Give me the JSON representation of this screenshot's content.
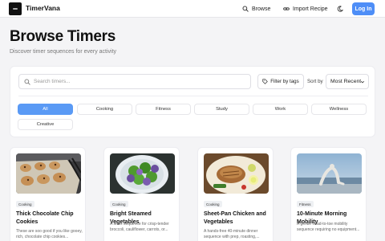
{
  "navbar": {
    "brand": "TimerVana",
    "logo_icon": "stopwatch-logo-icon",
    "links": [
      {
        "label": "Browse",
        "icon": "search-icon"
      },
      {
        "label": "Import Recipe",
        "icon": "link-icon"
      }
    ],
    "theme_icon": "moon-icon",
    "login_label": "Log In"
  },
  "header": {
    "title": "Browse Timers",
    "subtitle": "Discover timer sequences for every activity"
  },
  "filters": {
    "search_placeholder": "Search timers...",
    "filter_label": "Filter by tags",
    "filter_icon": "tag-icon",
    "sort_label": "Sort by",
    "sort_value": "Most Recent",
    "categories": [
      {
        "label": "All",
        "active": true
      },
      {
        "label": "Cooking",
        "active": false
      },
      {
        "label": "Fitness",
        "active": false
      },
      {
        "label": "Study",
        "active": false
      },
      {
        "label": "Work",
        "active": false
      },
      {
        "label": "Wellness",
        "active": false
      },
      {
        "label": "Creative",
        "active": false
      }
    ]
  },
  "cards": [
    {
      "tag": "Cooking",
      "title": "Thick Chocolate Chip Cookies",
      "description": "These are soo good if you like gooey, rich, chocolate chip cookies..."
    },
    {
      "tag": "Cooking",
      "title": "Bright Steamed Vegetables",
      "description": "A short sequence for crisp-tender broccoli, cauliflower, carrots, or..."
    },
    {
      "tag": "Cooking",
      "title": "Sheet-Pan Chicken and Vegetables",
      "description": "A hands-free 40-minute dinner sequence with prep, roasting,..."
    },
    {
      "tag": "Fitness",
      "title": "10-Minute Morning Mobility",
      "description": "A gentle head-to-toe mobility sequence requiring no equipment..."
    }
  ],
  "colors": {
    "accent": "#4e8ef7",
    "chip_active": "#5a9af5",
    "page_bg": "#f4f4f6"
  }
}
